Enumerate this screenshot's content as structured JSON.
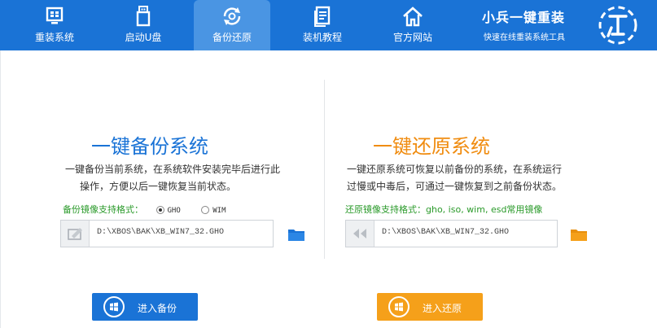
{
  "nav": {
    "items": [
      {
        "label": "重装系统",
        "icon": "monitor-icon"
      },
      {
        "label": "启动U盘",
        "icon": "usb-drive-icon"
      },
      {
        "label": "备份还原",
        "icon": "backup-restore-icon",
        "active": true
      },
      {
        "label": "装机教程",
        "icon": "document-icon"
      },
      {
        "label": "官方网站",
        "icon": "home-icon"
      }
    ]
  },
  "brand": {
    "title": "小兵一键重装",
    "subtitle": "快速在线重装系统工具",
    "badge_icon": "brand-logo-icon"
  },
  "backup": {
    "title": "一键备份系统",
    "desc_line1": "一键备份当前系统，在系统软件安装完毕后进行此",
    "desc_line2": "操作，方便以后一键恢复当前状态。",
    "format_label": "备份镜像支持格式：",
    "option_gho": "GHO",
    "option_wim": "WIM",
    "path": "D:\\XBOS\\BAK\\XB_WIN7_32.GHO",
    "button": "进入备份",
    "color": "#1a73d6"
  },
  "restore": {
    "title": "一键还原系统",
    "desc_line1": "一键还原系统可恢复以前备份的系统，在系统运行",
    "desc_line2": "过慢或中毒后，可通过一键恢复到之前备份状态。",
    "format_label": "还原镜像支持格式：gho, iso, wim, esd常用镜像",
    "path": "D:\\XBOS\\BAK\\XB_WIN7_32.GHO",
    "button": "进入还原",
    "color": "#f5a01a"
  },
  "colors": {
    "header": "#1a73d6",
    "format_label": "#2a9a2a"
  }
}
